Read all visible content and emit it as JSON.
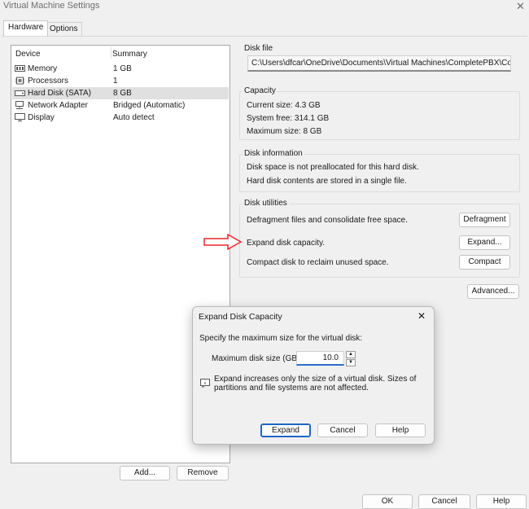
{
  "window": {
    "title": "Virtual Machine Settings",
    "close_glyph": "✕"
  },
  "tabs": [
    {
      "label": "Hardware"
    },
    {
      "label": "Options"
    }
  ],
  "device_list": {
    "headers": {
      "device": "Device",
      "summary": "Summary"
    },
    "rows": [
      {
        "name": "Memory",
        "summary": "1 GB",
        "icon": "memory-icon"
      },
      {
        "name": "Processors",
        "summary": "1",
        "icon": "processor-icon"
      },
      {
        "name": "Hard Disk (SATA)",
        "summary": "8 GB",
        "icon": "hard-disk-icon"
      },
      {
        "name": "Network Adapter",
        "summary": "Bridged (Automatic)",
        "icon": "network-adapter-icon"
      },
      {
        "name": "Display",
        "summary": "Auto detect",
        "icon": "display-icon"
      }
    ],
    "add_label": "Add...",
    "remove_label": "Remove"
  },
  "disk_file": {
    "label": "Disk file",
    "path": "C:\\Users\\dfcar\\OneDrive\\Documents\\Virtual Machines\\CompletePBX\\Comple"
  },
  "capacity": {
    "label": "Capacity",
    "current": "Current size:  4.3 GB",
    "free": "System free:  314.1 GB",
    "max": "Maximum size:  8 GB"
  },
  "disk_info": {
    "label": "Disk information",
    "line1": "Disk space is not preallocated for this hard disk.",
    "line2": "Hard disk contents are stored in a single file."
  },
  "disk_utilities": {
    "label": "Disk utilities",
    "defrag_text": "Defragment files and consolidate free space.",
    "defrag_button": "Defragment",
    "expand_text": "Expand disk capacity.",
    "expand_button": "Expand...",
    "compact_text": "Compact disk to reclaim unused space.",
    "compact_button": "Compact"
  },
  "advanced_label": "Advanced...",
  "footer": {
    "ok": "OK",
    "cancel": "Cancel",
    "help": "Help"
  },
  "dialog": {
    "title": "Expand Disk Capacity",
    "close_glyph": "✕",
    "instruction": "Specify the maximum size for the virtual disk:",
    "size_label": "Maximum disk size (GB):",
    "size_value": "10.0",
    "info_line1": "Expand increases only the size of a virtual disk. Sizes of",
    "info_line2": "partitions and file systems are not affected.",
    "expand_button": "Expand",
    "cancel_button": "Cancel",
    "help_button": "Help"
  },
  "colors": {
    "arrow": "#e8282b",
    "focus_border": "#1f66c4",
    "selection": "#e0e0e0"
  }
}
